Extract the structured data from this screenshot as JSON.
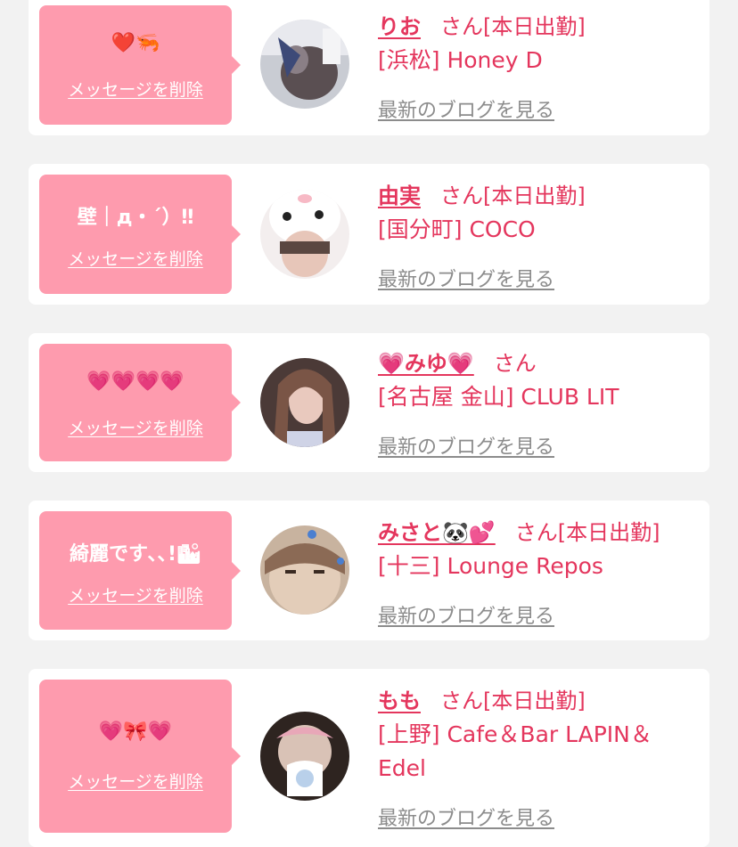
{
  "colors": {
    "background": "#f2f2f2",
    "card": "#ffffff",
    "bubble": "#fe9bae",
    "accent": "#e4365d",
    "link_gray": "#8c8c8c"
  },
  "cards": [
    {
      "message": "❤️🦐",
      "delete_label": "メッセージを削除",
      "name": "りお",
      "honorific": "さん[本日出勤]",
      "shop": "[浜松] Honey D",
      "blog_link": "最新のブログを見る"
    },
    {
      "message": "壁｜д・´）‼",
      "delete_label": "メッセージを削除",
      "name": "由実",
      "honorific": "さん[本日出勤]",
      "shop": "[国分町] COCO",
      "blog_link": "最新のブログを見る"
    },
    {
      "message": "💗💗💗💗",
      "delete_label": "メッセージを削除",
      "name": "💗みゆ💗",
      "honorific": "さん",
      "shop": "[名古屋 金山] CLUB LIT",
      "blog_link": "最新のブログを見る"
    },
    {
      "message": "綺麗です､､!🏙",
      "delete_label": "メッセージを削除",
      "name": "みさと🐼💕",
      "honorific": "さん[本日出勤]",
      "shop": "[十三] Lounge Repos",
      "blog_link": "最新のブログを見る"
    },
    {
      "message": "💗🎀💗",
      "delete_label": "メッセージを削除",
      "name": "もも",
      "honorific": "さん[本日出勤]",
      "shop": "[上野] Cafe＆Bar LAPIN＆Edel",
      "blog_link": "最新のブログを見る"
    }
  ]
}
